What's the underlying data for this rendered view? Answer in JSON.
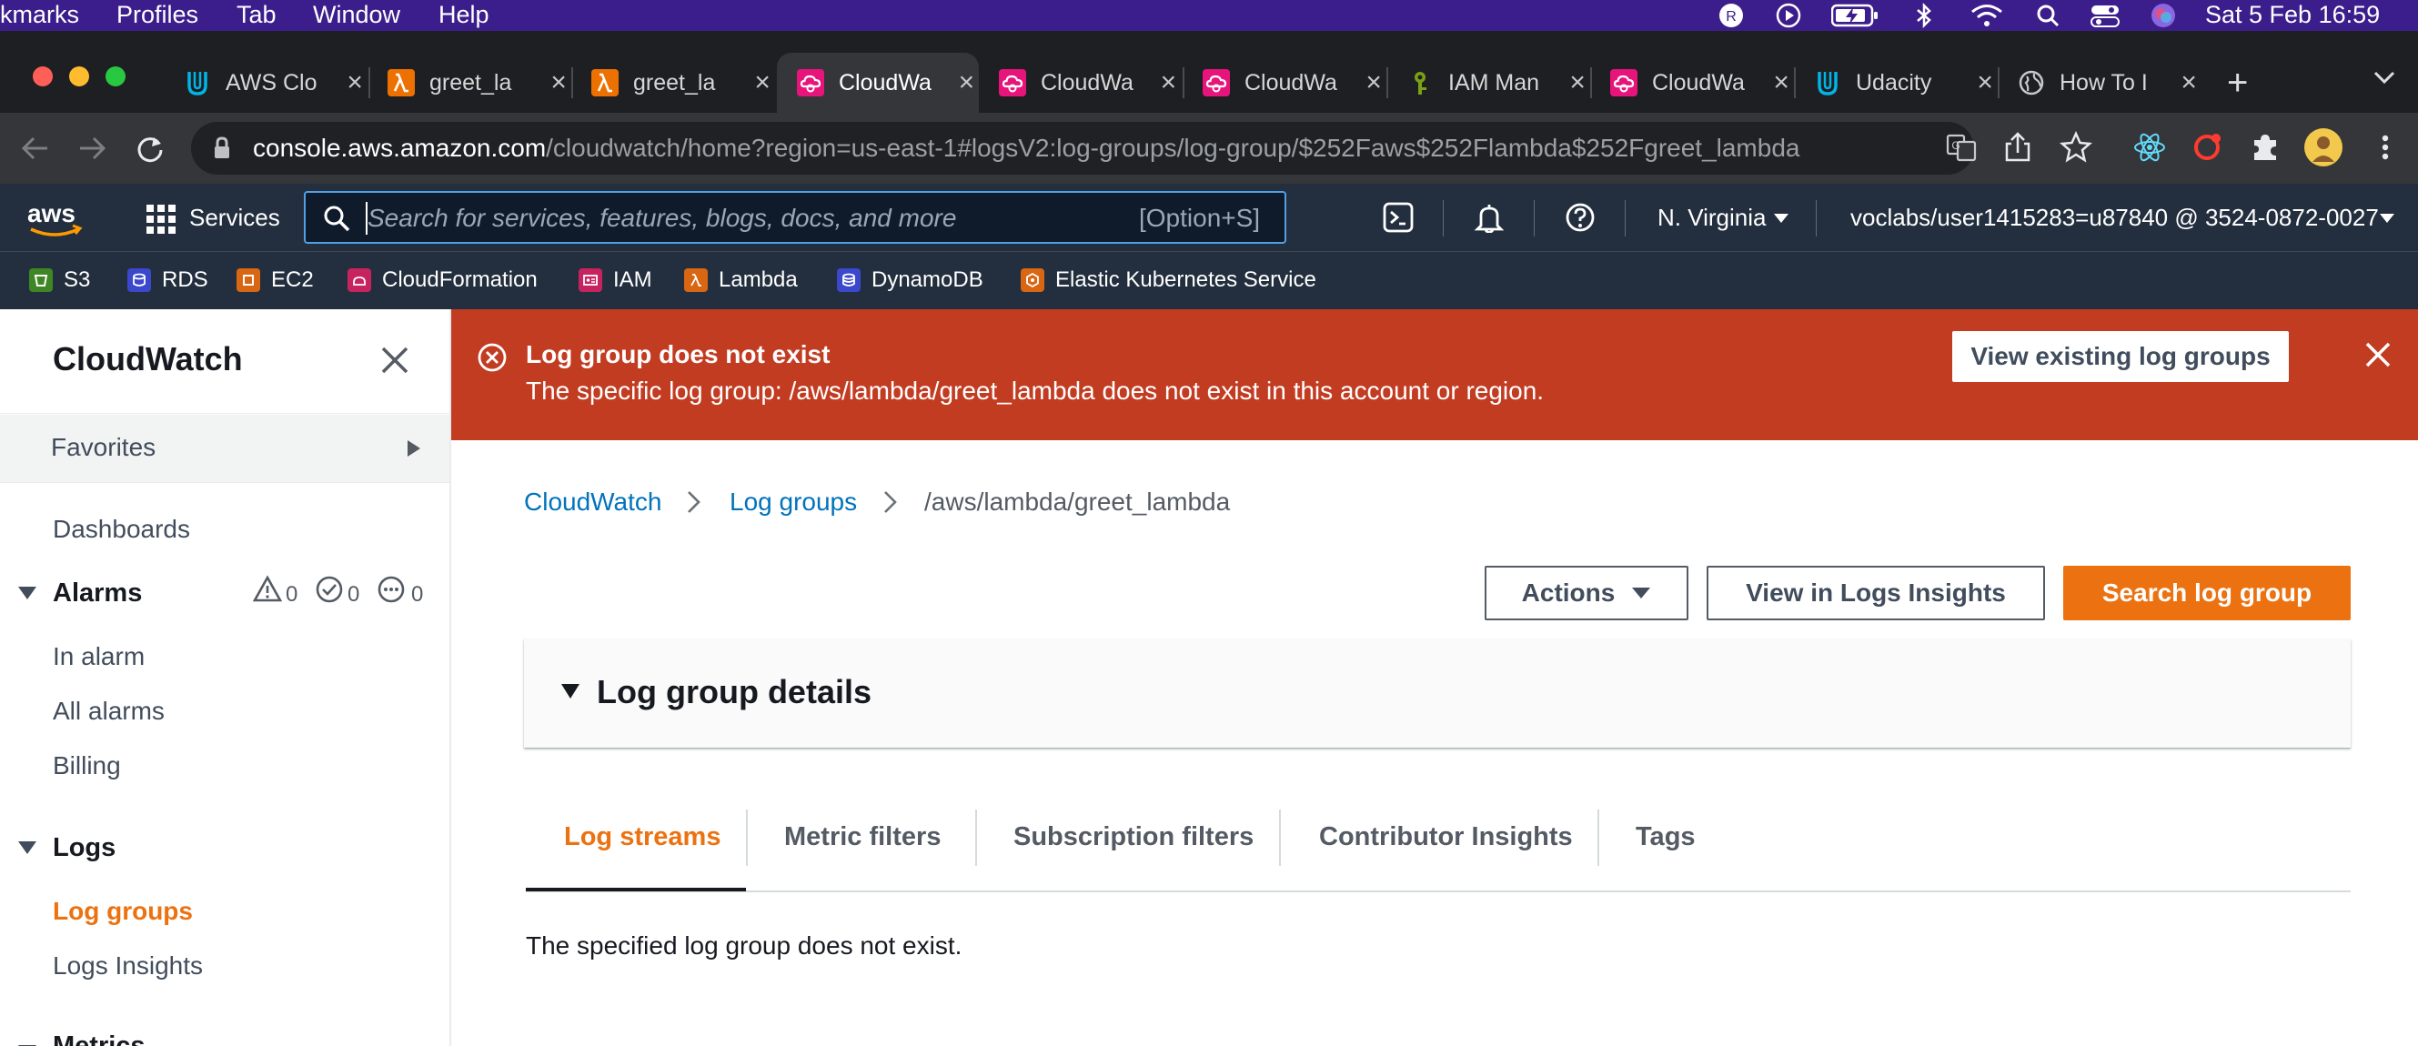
{
  "os_menu": {
    "items": [
      "kmarks",
      "Profiles",
      "Tab",
      "Window",
      "Help"
    ],
    "clock": "Sat 5 Feb  16:59"
  },
  "browser": {
    "tabs": [
      {
        "title": "AWS Clo",
        "icon": "udacity-icon"
      },
      {
        "title": "greet_la",
        "icon": "lambda-icon"
      },
      {
        "title": "greet_la",
        "icon": "lambda-icon"
      },
      {
        "title": "CloudWa",
        "icon": "cloudwatch-icon"
      },
      {
        "title": "CloudWa",
        "icon": "cloudwatch-icon"
      },
      {
        "title": "CloudWa",
        "icon": "cloudwatch-icon"
      },
      {
        "title": "IAM Man",
        "icon": "iam-icon"
      },
      {
        "title": "CloudWa",
        "icon": "cloudwatch-icon"
      },
      {
        "title": "Udacity",
        "icon": "udacity-icon"
      },
      {
        "title": "How To I",
        "icon": "globe-icon"
      }
    ],
    "url_host": "console.aws.amazon.com",
    "url_path": "/cloudwatch/home?region=us-east-1#logsV2:log-groups/log-group/$252Faws$252Flambda$252Fgreet_lambda"
  },
  "aws_nav": {
    "logo": "aws",
    "services_label": "Services",
    "search_placeholder": "Search for services, features, blogs, docs, and more",
    "search_shortcut": "[Option+S]",
    "region": "N. Virginia",
    "account": "voclabs/user1415283=u87840 @ 3524-0872-0027"
  },
  "favorites_bar": [
    {
      "label": "S3",
      "color": "#3f8624"
    },
    {
      "label": "RDS",
      "color": "#3b48cc"
    },
    {
      "label": "EC2",
      "color": "#d86613"
    },
    {
      "label": "CloudFormation",
      "color": "#c7235e"
    },
    {
      "label": "IAM",
      "color": "#c7235e"
    },
    {
      "label": "Lambda",
      "color": "#d86613"
    },
    {
      "label": "DynamoDB",
      "color": "#3b48cc"
    },
    {
      "label": "Elastic Kubernetes Service",
      "color": "#d86613"
    }
  ],
  "sidebar": {
    "title": "CloudWatch",
    "favorites": "Favorites",
    "dashboards": "Dashboards",
    "alarms": "Alarms",
    "alarm_counts": {
      "alarm": "0",
      "ok": "0",
      "insufficient": "0"
    },
    "alarm_items": [
      "In alarm",
      "All alarms",
      "Billing"
    ],
    "logs": "Logs",
    "log_items": [
      "Log groups",
      "Logs Insights"
    ],
    "metrics": "Metrics"
  },
  "flash": {
    "title": "Log group does not exist",
    "message": "The specific log group: /aws/lambda/greet_lambda does not exist in this account or region.",
    "button": "View existing log groups"
  },
  "breadcrumb": [
    "CloudWatch",
    "Log groups",
    "/aws/lambda/greet_lambda"
  ],
  "actions": {
    "actions": "Actions",
    "insights": "View in Logs Insights",
    "search": "Search log group"
  },
  "details": {
    "title": "Log group details"
  },
  "tabs": [
    "Log streams",
    "Metric filters",
    "Subscription filters",
    "Contributor Insights",
    "Tags"
  ],
  "empty_message": "The specified log group does not exist.",
  "colors": {
    "aws_nav": "#232f3e",
    "error": "#c23c22",
    "accent": "#ec7211",
    "link": "#0073bb"
  }
}
